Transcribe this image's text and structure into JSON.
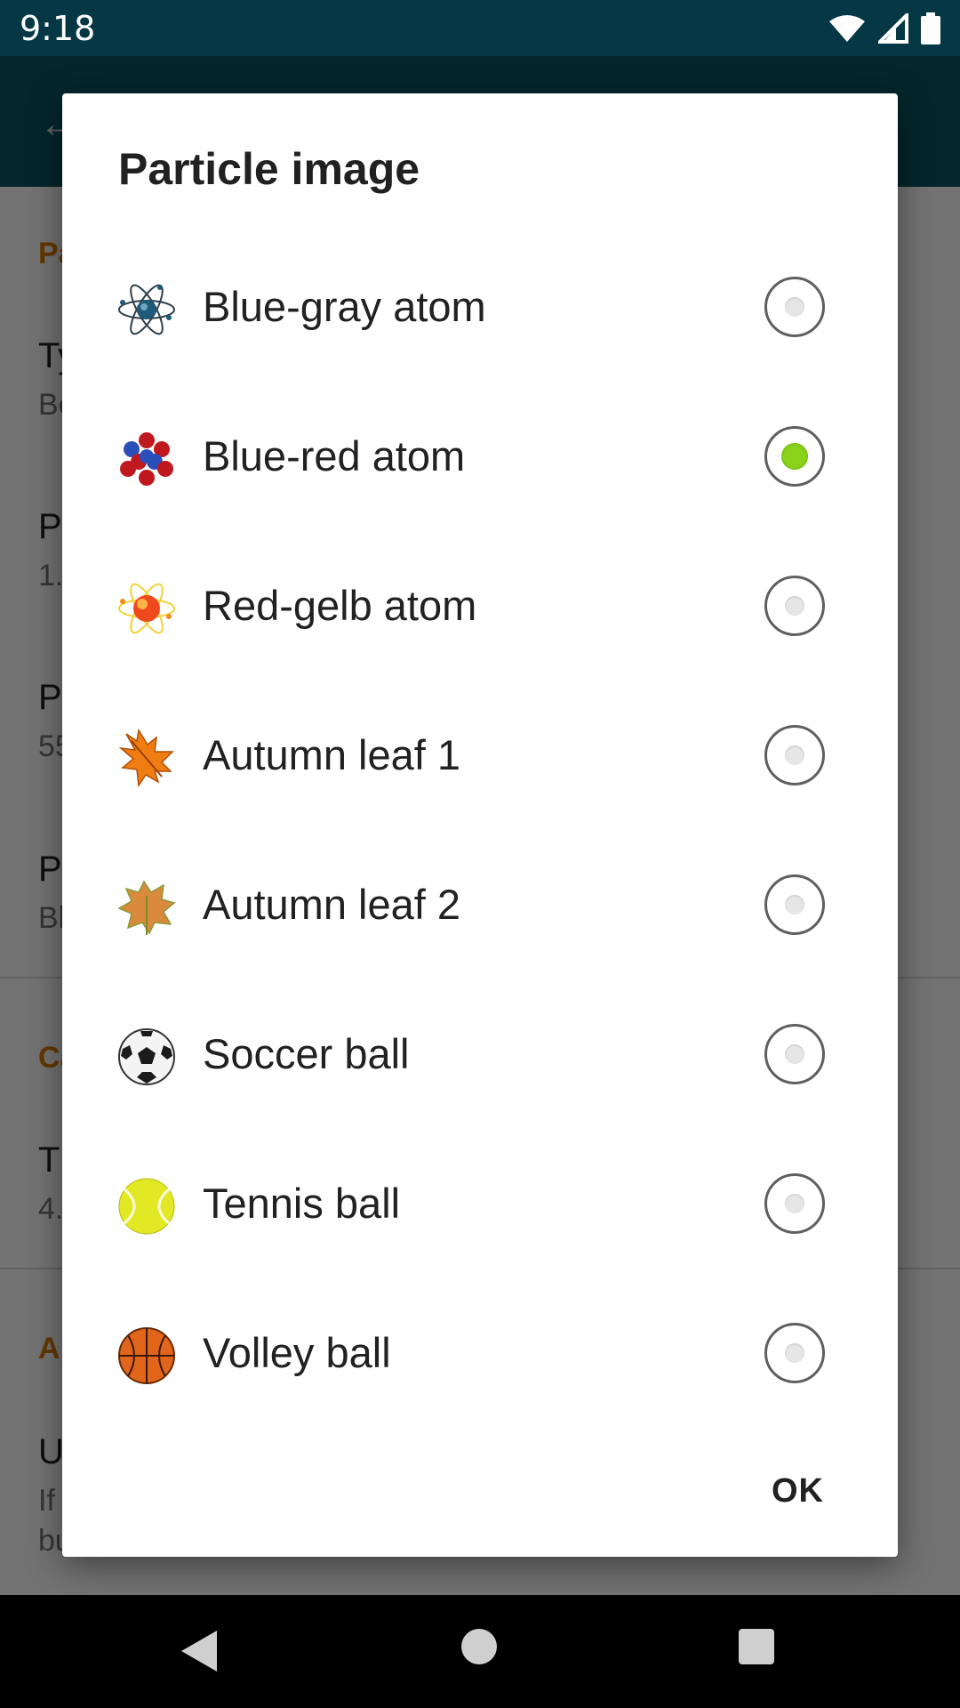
{
  "status_bar": {
    "time": "9:18"
  },
  "background_settings": {
    "categories": [
      "Pa",
      "Ca",
      "Ap"
    ],
    "items": [
      {
        "title": "Ty",
        "summary": "Be"
      },
      {
        "title": "P",
        "summary": "1."
      },
      {
        "title": "P",
        "summary": "55"
      },
      {
        "title": "P",
        "summary": "Bl"
      },
      {
        "title": "T",
        "summary": "4."
      },
      {
        "title": "U",
        "summary": "If"
      }
    ],
    "extra_summary": "bu"
  },
  "dialog": {
    "title": "Particle image",
    "options": [
      {
        "label": "Blue-gray atom",
        "icon": "blue-gray-atom-icon",
        "selected": false
      },
      {
        "label": "Blue-red atom",
        "icon": "blue-red-atom-icon",
        "selected": true
      },
      {
        "label": "Red-gelb atom",
        "icon": "red-gelb-atom-icon",
        "selected": false
      },
      {
        "label": "Autumn leaf 1",
        "icon": "autumn-leaf-1-icon",
        "selected": false
      },
      {
        "label": "Autumn leaf 2",
        "icon": "autumn-leaf-2-icon",
        "selected": false
      },
      {
        "label": "Soccer ball",
        "icon": "soccer-ball-icon",
        "selected": false
      },
      {
        "label": "Tennis ball",
        "icon": "tennis-ball-icon",
        "selected": false
      },
      {
        "label": "Volley ball",
        "icon": "volley-ball-icon",
        "selected": false
      }
    ],
    "ok_label": "OK"
  },
  "colors": {
    "status_bar": "#053844",
    "app_bar": "#0b5563",
    "accent_category": "#e07b00",
    "radio_selected": "#8bd31a"
  }
}
